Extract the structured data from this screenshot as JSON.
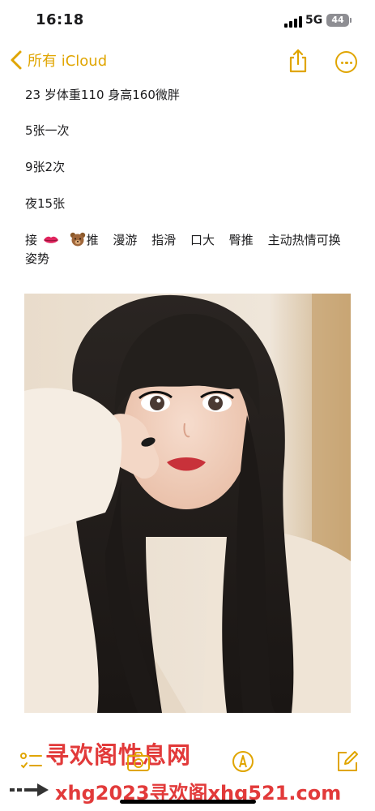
{
  "status_bar": {
    "time": "16:18",
    "network": "5G",
    "battery": "44"
  },
  "nav": {
    "back_label": "所有 iCloud",
    "accent_color": "#e0a500",
    "icons": [
      "chevron-left-icon",
      "share-icon",
      "more-icon"
    ]
  },
  "note": {
    "lines": [
      "23 岁体重110 身高160微胖",
      "5张一次",
      "9张2次",
      "夜15张"
    ],
    "tags_prefix": "接",
    "tags": [
      "推",
      "漫游",
      "指滑",
      "口大",
      "臀推",
      "主动热情可换姿势"
    ]
  },
  "photo": {
    "subject": "selfie-photo"
  },
  "watermark": {
    "top": "寻欢阁性息网",
    "bottom": "xhg2023寻欢阁xhg521.com",
    "color": "#e23a3a"
  },
  "toolbar": {
    "icons": [
      "checklist-icon",
      "camera-icon",
      "pen-markup-icon",
      "compose-icon"
    ]
  }
}
